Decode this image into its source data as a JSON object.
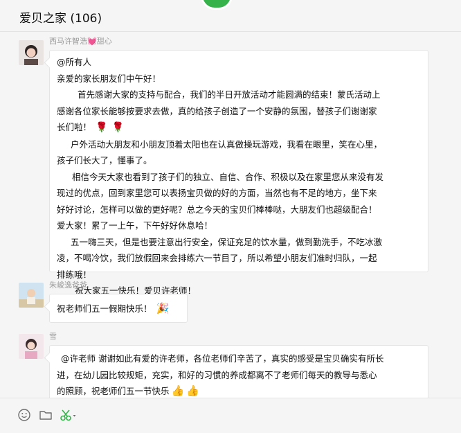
{
  "window": {
    "title": "爱贝之家 (106)"
  },
  "colors": {
    "accent": "#35b24a",
    "bubble": "#ffffff",
    "name_text": "#9a9a9a",
    "background": "#f5f5f5"
  },
  "messages": [
    {
      "sender": "西马许智浩💓甜心",
      "lines": [
        "@所有人",
        "亲爱的家长朋友们中午好！",
        "首先感谢大家的支持与配合，我们的半日开放活动才能圆满的结束！蒙氏活动上",
        "感谢各位家长能够按要求去做，真的给孩子创造了一个安静的氛围，替孩子们谢谢家",
        "长们啦！",
        "户外活动大朋友和小朋友顶着太阳也在认真做操玩游戏，我看在眼里，笑在心里，",
        "孩子们长大了，懂事了。",
        "相信今天大家也看到了孩子们的独立、自信、合作、积极以及在家里您从来没有发",
        "现过的优点，回到家里您可以表扬宝贝做的好的方面，当然也有不足的地方，坐下来",
        "好好讨论，怎样可以做的更好呢？总之今天的宝贝们棒棒哒，大朋友们也超级配合！",
        "爱大家！累了一上午，下午好好休息哈！",
        "五一嗨三天，但是也要注意出行安全，保证充足的饮水量，做到勤洗手，不吃冰激",
        "凌，不喝冷饮，我们放假回来会排练六一节目了，所以希望小朋友们准时归队，一起",
        "排练哦！",
        "祝大家五一快乐！爱贝许老师！"
      ]
    },
    {
      "sender": "朱峻逸爸爸",
      "lines": [
        "祝老师们五一假期快乐！"
      ]
    },
    {
      "sender": "雪",
      "lines": [
        "@许老师 谢谢如此有爱的许老师，各位老师们辛苦了，真实的感受是宝贝确实有所长",
        "进，在幼儿园比较规矩，充实，和好的习惯的养成都离不了老师们每天的教导与悉心",
        "的照顾，祝老师们五一节快乐"
      ]
    }
  ],
  "toolbar": {
    "icons": [
      "emoji-icon",
      "folder-icon",
      "scissors-icon"
    ]
  }
}
